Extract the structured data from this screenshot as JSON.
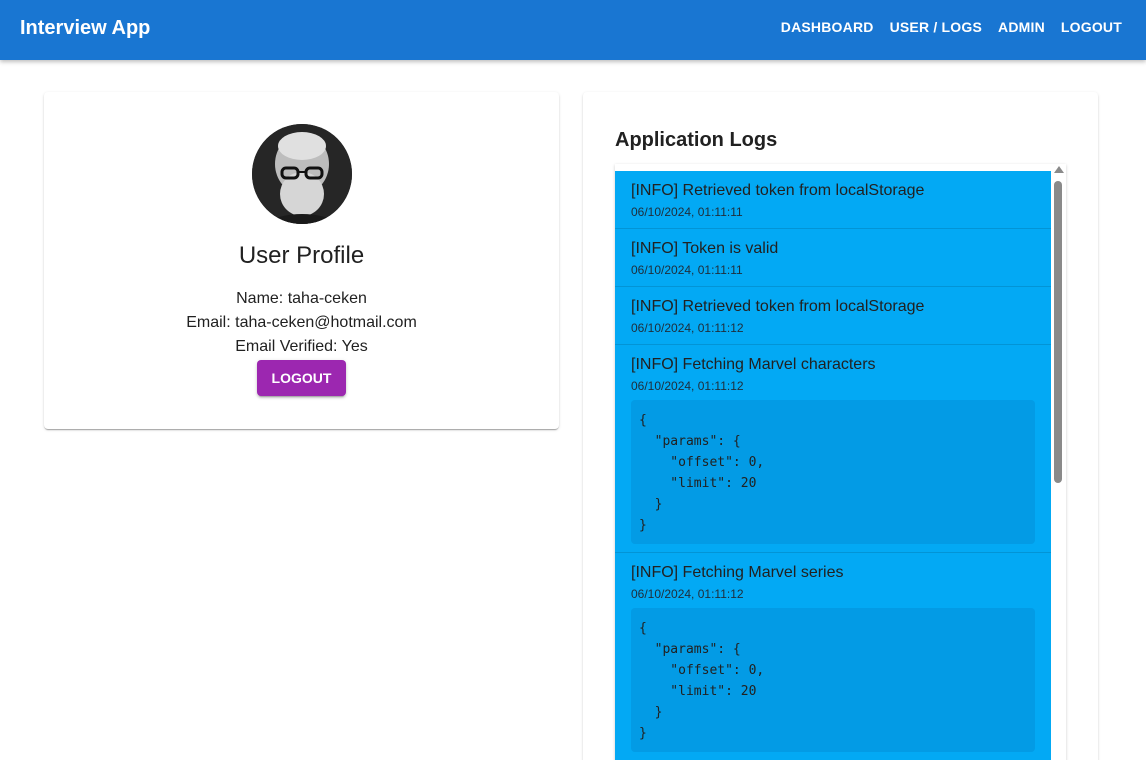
{
  "app": {
    "title": "Interview App"
  },
  "nav": {
    "items": [
      "DASHBOARD",
      "USER / LOGS",
      "ADMIN",
      "LOGOUT"
    ]
  },
  "profile": {
    "title": "User Profile",
    "name": "Name: taha-ceken",
    "email": "Email: taha-ceken@hotmail.com",
    "verified": "Email Verified: Yes",
    "logout_label": "LOGOUT"
  },
  "logs": {
    "title": "Application Logs",
    "items": [
      {
        "message": "[INFO] Retrieved token from localStorage",
        "time": "06/10/2024, 01:11:11"
      },
      {
        "message": "[INFO] Token is valid",
        "time": "06/10/2024, 01:11:11"
      },
      {
        "message": "[INFO] Retrieved token from localStorage",
        "time": "06/10/2024, 01:11:12"
      },
      {
        "message": "[INFO] Fetching Marvel characters",
        "time": "06/10/2024, 01:11:12",
        "details": "{\n  \"params\": {\n    \"offset\": 0,\n    \"limit\": 20\n  }\n}"
      },
      {
        "message": "[INFO] Fetching Marvel series",
        "time": "06/10/2024, 01:11:12",
        "details": "{\n  \"params\": {\n    \"offset\": 0,\n    \"limit\": 20\n  }\n}"
      }
    ]
  },
  "colors": {
    "appbar": "#1976d2",
    "logout_button": "#9c27b0",
    "log_background": "#03a9f4",
    "log_details_background": "#039be5"
  },
  "icons": {
    "scroll_up": "triangle-up-icon"
  }
}
